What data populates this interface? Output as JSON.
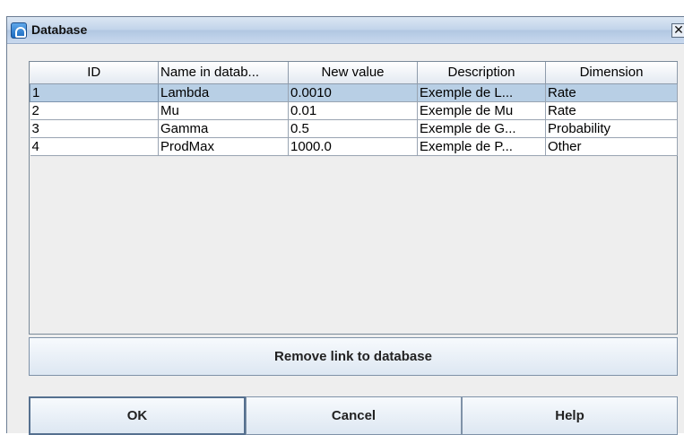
{
  "window": {
    "title": "Database",
    "close_label": "✕"
  },
  "table": {
    "columns": [
      "ID",
      "Name in datab...",
      "New value",
      "Description",
      "Dimension"
    ],
    "rows": [
      [
        "1",
        "Lambda",
        "0.0010",
        "Exemple de L...",
        "Rate"
      ],
      [
        "2",
        "Mu",
        "0.01",
        "Exemple de Mu",
        "Rate"
      ],
      [
        "3",
        "Gamma",
        "0.5",
        "Exemple de G...",
        "Probability"
      ],
      [
        "4",
        "ProdMax",
        "1000.0",
        "Exemple de P...",
        "Other"
      ]
    ],
    "selected_row": 0
  },
  "buttons": {
    "remove_link": "Remove link to database",
    "ok": "OK",
    "cancel": "Cancel",
    "help": "Help"
  }
}
